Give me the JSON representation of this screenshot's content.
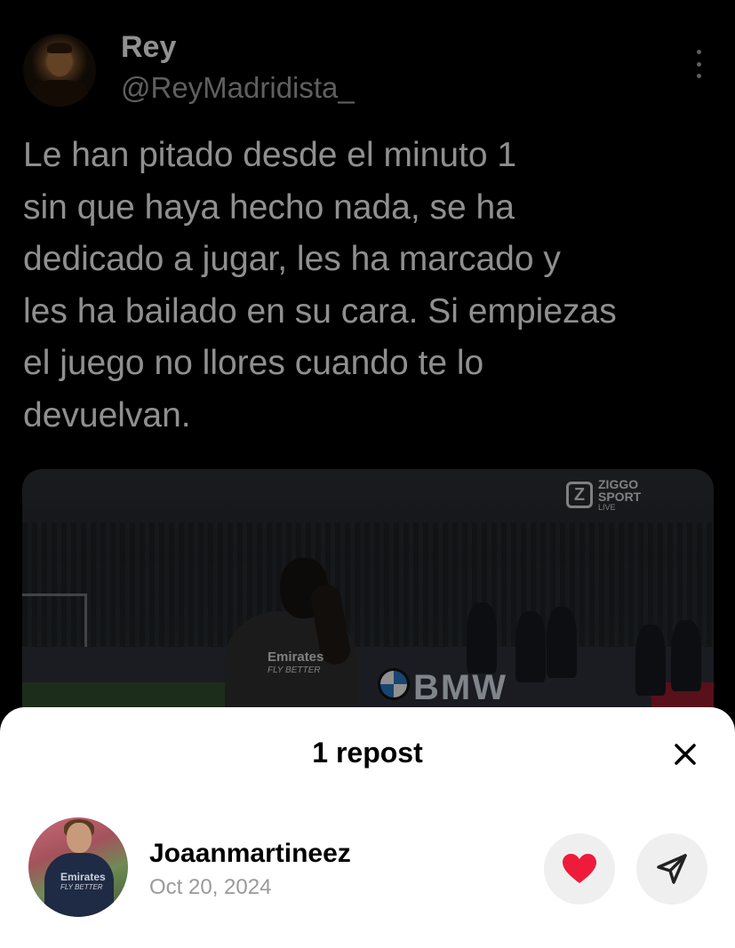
{
  "tweet": {
    "author_name": "Rey",
    "author_handle": "@ReyMadridista_",
    "text_lines": [
      "Le han pitado desde el minuto 1",
      "sin que haya hecho nada, se ha",
      "dedicado a jugar, les ha marcado y",
      "les ha bailado en su cara. Si empiezas",
      "el juego no llores cuando te lo",
      "devuelvan."
    ],
    "media": {
      "broadcaster_top": "ZIGGO",
      "broadcaster_bottom": "SPORT",
      "broadcaster_live": "LIVE",
      "ad_board_text": "BMW",
      "shirt_sponsor": "Emirates",
      "shirt_sponsor_tagline": "FLY BETTER"
    },
    "more_icon": "more-vertical-icon"
  },
  "sheet": {
    "title": "1 repost",
    "close_icon": "close-icon",
    "reposter": {
      "name": "Joaanmartineez",
      "date": "Oct 20, 2024",
      "shirt_sponsor": "Emirates",
      "shirt_sponsor_tagline": "FLY BETTER"
    },
    "like_icon": "heart-icon",
    "share_icon": "send-icon",
    "colors": {
      "heart": "#ee1c3a",
      "button_bg": "#efefef"
    }
  }
}
